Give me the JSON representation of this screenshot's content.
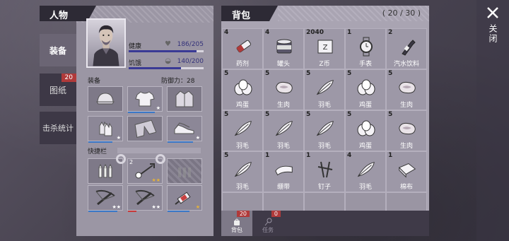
{
  "character": {
    "title": "人物",
    "tabs": [
      {
        "label": "装备",
        "active": true
      },
      {
        "label": "图纸",
        "badge": "20"
      },
      {
        "label": "击杀统计"
      }
    ],
    "stats": [
      {
        "label": "健康",
        "value": "186/205",
        "level": 0.907
      },
      {
        "label": "饥饿",
        "value": "140/200",
        "level": 0.7
      }
    ],
    "equipment_label": "装备",
    "defense_label": "防御力：28",
    "quickbar_label": "快捷栏",
    "equipment_slots": [
      {
        "icon": "cap-icon"
      },
      {
        "icon": "shirt-icon",
        "stars": "★",
        "durability": 0.8
      },
      {
        "icon": "jacket-icon"
      },
      {
        "icon": "gloves-icon",
        "stars": "★",
        "durability": 0.7
      },
      {
        "icon": "pants-icon"
      },
      {
        "icon": "shoes-icon",
        "stars": "★",
        "durability": 0.75
      }
    ],
    "quick_slots": [
      {
        "icon": "ammo-icon"
      },
      {
        "icon": "keyring-icon",
        "count": "2",
        "stars": "★★",
        "gold": true
      },
      {
        "icon": "ammo-empty-icon",
        "hatched": true
      },
      {
        "icon": "crossbow-icon",
        "stars": "★★",
        "durability": 0.85
      },
      {
        "icon": "crossbow-icon",
        "stars": "★★",
        "durability": 0.25,
        "red": true
      },
      {
        "icon": "syringe-icon",
        "stars": "★",
        "gold": true,
        "durability": 0.65
      }
    ]
  },
  "backpack": {
    "title": "背包",
    "capacity": "( 20 / 30 )",
    "items": [
      {
        "count": "4",
        "name": "药剂",
        "icon": "medicine-icon"
      },
      {
        "count": "4",
        "name": "罐头",
        "icon": "can-icon"
      },
      {
        "count": "2040",
        "name": "Z币",
        "icon": "coin-icon"
      },
      {
        "count": "1",
        "name": "手表",
        "icon": "watch-icon"
      },
      {
        "count": "2",
        "name": "汽水饮料",
        "icon": "soda-icon"
      },
      {
        "count": "5",
        "name": "鸡蛋",
        "icon": "egg-icon"
      },
      {
        "count": "5",
        "name": "生肉",
        "icon": "meat-icon"
      },
      {
        "count": "5",
        "name": "羽毛",
        "icon": "feather-icon"
      },
      {
        "count": "5",
        "name": "鸡蛋",
        "icon": "egg-icon"
      },
      {
        "count": "5",
        "name": "生肉",
        "icon": "meat-icon"
      },
      {
        "count": "5",
        "name": "羽毛",
        "icon": "feather-icon"
      },
      {
        "count": "5",
        "name": "羽毛",
        "icon": "feather-icon"
      },
      {
        "count": "5",
        "name": "羽毛",
        "icon": "feather-icon"
      },
      {
        "count": "5",
        "name": "鸡蛋",
        "icon": "egg-icon"
      },
      {
        "count": "5",
        "name": "生肉",
        "icon": "meat-icon"
      },
      {
        "count": "5",
        "name": "羽毛",
        "icon": "feather-icon"
      },
      {
        "count": "1",
        "name": "绷带",
        "icon": "bandage-icon"
      },
      {
        "count": "1",
        "name": "钉子",
        "icon": "nails-icon"
      },
      {
        "count": "4",
        "name": "羽毛",
        "icon": "feather-icon"
      },
      {
        "count": "1",
        "name": "棉布",
        "icon": "cloth-icon"
      },
      {
        "count": "",
        "name": ""
      },
      {
        "count": "",
        "name": ""
      },
      {
        "count": "",
        "name": ""
      },
      {
        "count": "",
        "name": ""
      },
      {
        "count": "",
        "name": ""
      }
    ],
    "footer_tabs": [
      {
        "label": "背包",
        "badge": "20",
        "active": true,
        "icon": "bag-icon"
      },
      {
        "label": "任务",
        "badge": "0",
        "active": false,
        "icon": "quest-icon"
      }
    ]
  },
  "close": {
    "label": "关闭"
  },
  "colors": {
    "accent_blue": "#3a3a95",
    "badge_red": "#b03a3a",
    "star_gold": "#e4b23a"
  }
}
